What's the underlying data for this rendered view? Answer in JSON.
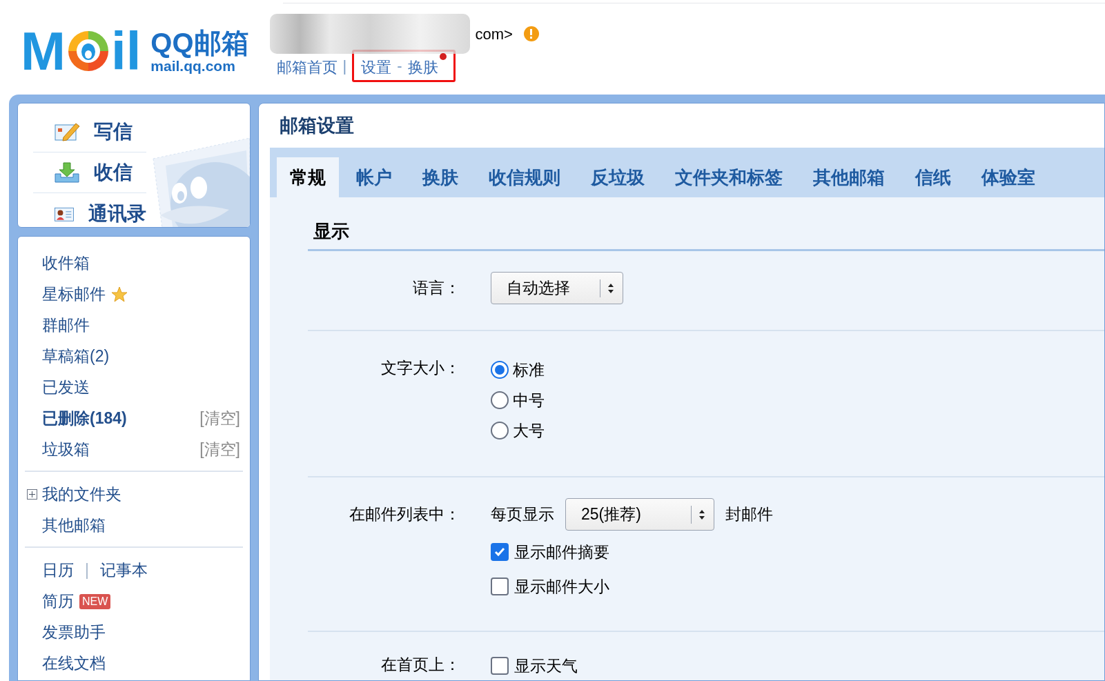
{
  "header": {
    "logo_letters": [
      "M",
      "il"
    ],
    "brand": "QQ邮箱",
    "domain": "mail.qq.com",
    "address_tail": "com>",
    "nav": [
      {
        "kind": "link",
        "text": "邮箱首页"
      },
      {
        "kind": "sep",
        "text": "|"
      }
    ],
    "highlighted_nav": [
      {
        "kind": "link",
        "text": "设置"
      },
      {
        "kind": "sep",
        "text": "-"
      },
      {
        "kind": "link",
        "text": "换肤",
        "dot": true
      }
    ]
  },
  "sidebar": {
    "actions": [
      {
        "kind": "compose",
        "label": "写信"
      },
      {
        "kind": "inbox",
        "label": "收信"
      },
      {
        "kind": "contacts",
        "label": "通讯录"
      }
    ],
    "groups": [
      [
        {
          "label": "收件箱",
          "bold": false
        },
        {
          "label": "星标邮件",
          "bold": false,
          "star": true
        },
        {
          "label": "群邮件",
          "bold": false
        },
        {
          "label": "草稿箱(2)",
          "bold": false
        },
        {
          "label": "已发送",
          "bold": false
        },
        {
          "label": "已删除(184)",
          "bold": true,
          "action": "[清空]"
        },
        {
          "label": "垃圾箱",
          "bold": false,
          "action": "[清空]"
        }
      ],
      [
        {
          "label": "我的文件夹",
          "bold": false,
          "expandable": true,
          "expanded": false
        },
        {
          "label": "其他邮箱",
          "bold": false
        }
      ],
      [
        {
          "label": "日历",
          "bold": false,
          "separator": "|",
          "second": "记事本"
        },
        {
          "label": "简历",
          "bold": false,
          "badge": "NEW"
        },
        {
          "label": "发票助手",
          "bold": false
        },
        {
          "label": "在线文档",
          "bold": false
        }
      ]
    ]
  },
  "main": {
    "title": "邮箱设置",
    "tabs": [
      {
        "label": "常规",
        "selected": true
      },
      {
        "label": "帐户",
        "selected": false
      },
      {
        "label": "换肤",
        "selected": false
      },
      {
        "label": "收信规则",
        "selected": false
      },
      {
        "label": "反垃圾",
        "selected": false
      },
      {
        "label": "文件夹和标签",
        "selected": false
      },
      {
        "label": "其他邮箱",
        "selected": false
      },
      {
        "label": "信纸",
        "selected": false
      },
      {
        "label": "体验室",
        "selected": false
      }
    ],
    "section": "显示",
    "rows": [
      {
        "kind": "select",
        "label": "语言：",
        "value": "自动选择"
      },
      {
        "kind": "radio",
        "label": "文字大小：",
        "options": [
          {
            "label": "标准",
            "selected": true
          },
          {
            "label": "中号",
            "selected": false
          },
          {
            "label": "大号",
            "selected": false
          }
        ]
      },
      {
        "kind": "list",
        "label": "在邮件列表中：",
        "prefix": "每页显示",
        "value": "25(推荐)",
        "suffix": "封邮件",
        "checks": [
          {
            "label": "显示邮件摘要",
            "checked": true
          },
          {
            "label": "显示邮件大小",
            "checked": false
          }
        ]
      },
      {
        "kind": "checks",
        "label": "在首页上：",
        "checks": [
          {
            "label": "显示天气",
            "checked": false
          }
        ]
      }
    ]
  }
}
